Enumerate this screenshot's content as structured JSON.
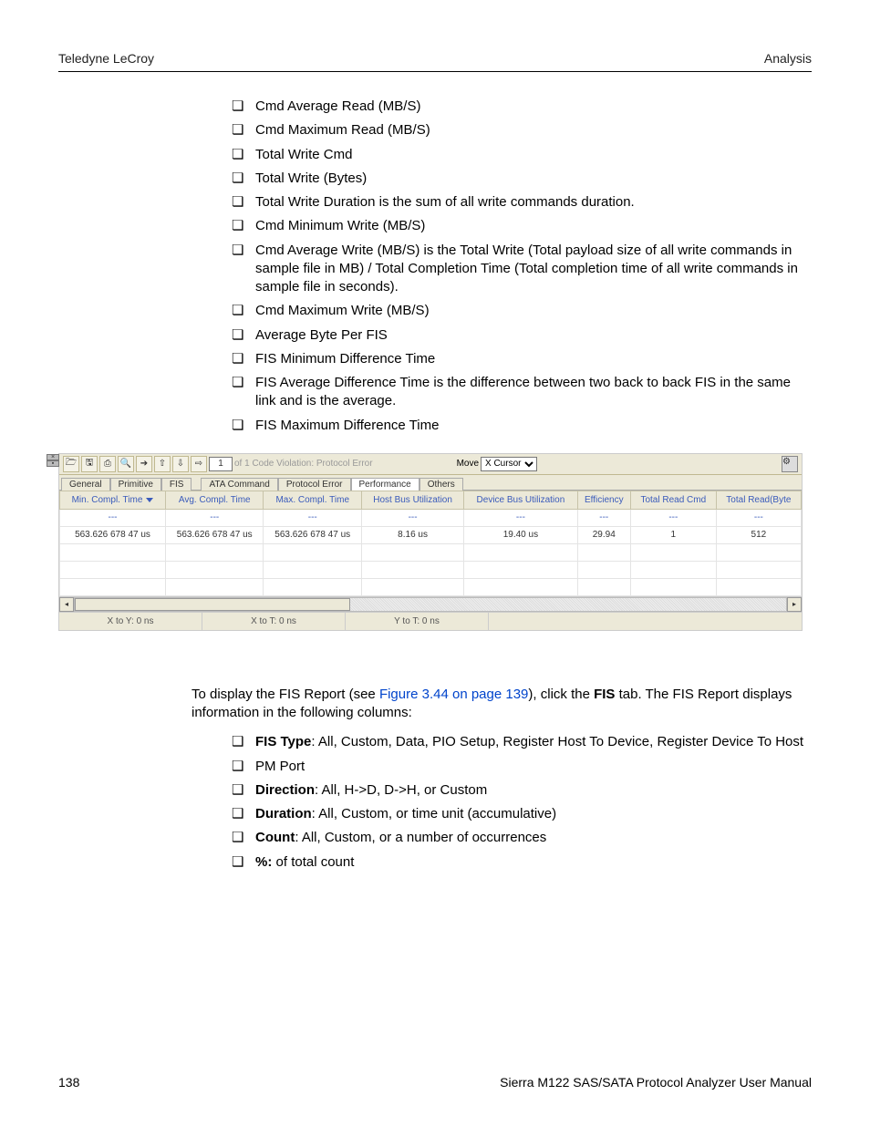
{
  "header": {
    "left": "Teledyne LeCroy",
    "right": "Analysis"
  },
  "list1": [
    "Cmd Average Read (MB/S)",
    "Cmd Maximum Read (MB/S)",
    "Total Write Cmd",
    "Total Write (Bytes)",
    "Total Write Duration is the sum of all write commands duration.",
    "Cmd Minimum Write (MB/S)",
    "Cmd Average Write (MB/S) is the Total Write (Total payload size of all write commands in sample file in MB) / Total Completion Time (Total completion time of all write commands in sample file in seconds).",
    "Cmd Maximum Write (MB/S)",
    "Average Byte Per FIS",
    "FIS Minimum Difference Time",
    "FIS Average Difference Time is the difference between two back to back FIS in the same link and is the average.",
    "FIS Maximum Difference Time"
  ],
  "para": {
    "pre": "To display the FIS Report (see ",
    "link": "Figure 3.44 on page 139",
    "post": "), click the ",
    "bold": "FIS",
    "post2": " tab. The FIS Report displays information in the following columns:"
  },
  "list2": [
    {
      "bold": "FIS Type",
      "rest": ": All, Custom, Data, PIO Setup, Register Host To Device, Register Device To Host"
    },
    {
      "bold": "",
      "rest": "PM Port"
    },
    {
      "bold": "Direction",
      "rest": ": All, H->D, D->H, or Custom"
    },
    {
      "bold": "Duration",
      "rest": ": All, Custom, or time unit (accumulative)"
    },
    {
      "bold": "Count",
      "rest": ": All, Custom, or a number of occurrences"
    },
    {
      "bold": "%:",
      "rest": " of total count"
    }
  ],
  "footer": {
    "page": "138",
    "manual": "Sierra M122 SAS/SATA Protocol Analyzer User Manual"
  },
  "app": {
    "toolbar": {
      "page_current": "1",
      "crumb": "of 1  Code Violation: Protocol Error",
      "move_label": "Move",
      "move_select": "X Cursor"
    },
    "tabs": [
      "General",
      "Primitive",
      "FIS",
      "ATA Command",
      "Protocol Error",
      "Performance",
      "Others"
    ],
    "active_tab": 5,
    "columns": [
      "Min. Compl. Time",
      "Avg. Compl. Time",
      "Max. Compl. Time",
      "Host Bus Utilization",
      "Device Bus Utilization",
      "Efficiency",
      "Total Read Cmd",
      "Total Read(Byte"
    ],
    "filter_row": [
      "---",
      "---",
      "---",
      "---",
      "---",
      "---",
      "---",
      "---"
    ],
    "data_row": [
      "563.626 678 47  us",
      "563.626 678 47  us",
      "563.626 678 47  us",
      "8.16  us",
      "19.40  us",
      "29.94",
      "1",
      "512"
    ],
    "status": {
      "xy": "X to Y:  0 ns",
      "xt": "X to T:  0 ns",
      "yt": "Y to T:  0 ns"
    }
  }
}
